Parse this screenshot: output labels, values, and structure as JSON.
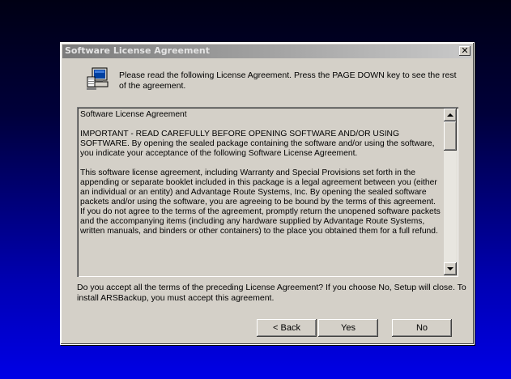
{
  "window": {
    "title": "Software License Agreement",
    "close_glyph": "✕"
  },
  "intro": {
    "icon": "setup-computer-icon",
    "text": "Please read the following License Agreement.  Press the PAGE DOWN key to see the rest of the agreement."
  },
  "license": {
    "paragraphs": [
      "Software License Agreement",
      "IMPORTANT - READ CAREFULLY BEFORE OPENING SOFTWARE AND/OR USING SOFTWARE.  By opening the sealed package containing the software and/or using the software, you indicate your acceptance of the following Software License Agreement.",
      "This software license agreement, including Warranty and Special Provisions set forth in the appending or separate booklet included in this package is a legal agreement between you (either an individual or an entity) and  Advantage Route Systems, Inc.  By opening the sealed software packets and/or using the software, you are agreeing to be bound by the terms of this agreement.  If you do not agree to the terms of the agreement, promptly return the unopened software packets and the accompanying items (including any hardware supplied by Advantage Route Systems, written manuals, and binders or other containers) to the place you obtained them for a full refund."
    ]
  },
  "question": "Do you accept all the terms of the preceding License Agreement?  If you choose No,  Setup will close.  To install ARSBackup, you must accept this agreement.",
  "buttons": {
    "back": "< Back",
    "yes": "Yes",
    "no": "No"
  },
  "colors": {
    "dialog_face": "#d4d0c8",
    "titlebar_inactive": "#808080",
    "desktop_top": "#000014",
    "desktop_bottom": "#0000e6"
  }
}
